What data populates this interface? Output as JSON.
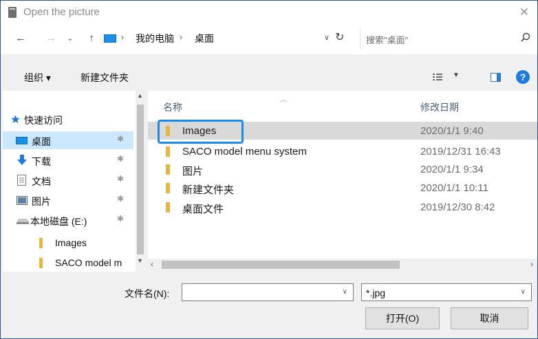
{
  "window": {
    "title": "Open the picture",
    "close_glyph": "✕"
  },
  "nav": {
    "back": "←",
    "forward": "→",
    "recent": "⌄",
    "up": "↑",
    "breadcrumb": [
      "我的电脑",
      "桌面"
    ],
    "separator": "›",
    "search_placeholder": "搜索\"桌面\""
  },
  "toolbar": {
    "organize": "组织 ▾",
    "new_folder": "新建文件夹",
    "help": "?"
  },
  "sidebar": {
    "items": [
      {
        "label": "快速访问",
        "icon": "star-icon",
        "pinned": false
      },
      {
        "label": "桌面",
        "icon": "desktop-icon",
        "pinned": true,
        "selected": true
      },
      {
        "label": "下载",
        "icon": "download-icon",
        "pinned": true
      },
      {
        "label": "文档",
        "icon": "document-icon",
        "pinned": true
      },
      {
        "label": "图片",
        "icon": "picture-icon",
        "pinned": true
      },
      {
        "label": "本地磁盘 (E:)",
        "icon": "drive-icon",
        "pinned": true
      },
      {
        "label": "Images",
        "icon": "folder-icon",
        "pinned": false
      },
      {
        "label": "SACO model m",
        "icon": "folder-icon",
        "pinned": false
      }
    ],
    "pin_glyph": "✱"
  },
  "files": {
    "columns": {
      "name": "名称",
      "modified": "修改日期"
    },
    "rows": [
      {
        "name": "Images",
        "date": "2020/1/1 9:40",
        "selected": true
      },
      {
        "name": "SACO model menu system",
        "date": "2019/12/31 16:43"
      },
      {
        "name": "图片",
        "date": "2020/1/1 9:34"
      },
      {
        "name": "新建文件夹",
        "date": "2020/1/1 10:11"
      },
      {
        "name": "桌面文件",
        "date": "2019/12/30 8:42"
      }
    ]
  },
  "footer": {
    "filename_label": "文件名(N):",
    "filename_value": "",
    "filetype": "*.jpg",
    "open": "打开(O)",
    "cancel": "取消"
  },
  "colors": {
    "accent": "#1a8be8",
    "selection": "#cce8ff",
    "folder": "#e8b53d"
  }
}
